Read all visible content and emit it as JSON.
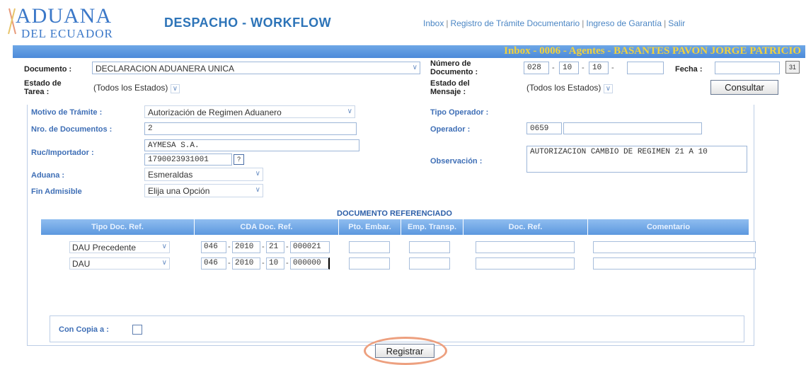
{
  "logo": {
    "main": "ADUANA",
    "sub": "DEL ECUADOR"
  },
  "app_title": "DESPACHO - WORKFLOW",
  "nav": [
    "Inbox",
    "Registro de Trámite Documentario",
    "Ingreso de Garantía",
    "Salir"
  ],
  "banner": "Inbox - 0006 - Agentes - BASANTES PAVON JORGE PATRICIO",
  "filters": {
    "documento_label": "Documento :",
    "documento_value": "DECLARACION ADUANERA UNICA",
    "numero_label_1": "Número de",
    "numero_label_2": "Documento :",
    "numero_parts": [
      "028",
      "10",
      "10",
      ""
    ],
    "fecha_label": "Fecha :",
    "fecha_value": "",
    "estado_tarea_label_1": "Estado de",
    "estado_tarea_label_2": "Tarea :",
    "estado_tarea_value": "(Todos los Estados)",
    "estado_mensaje_label_1": "Estado del",
    "estado_mensaje_label_2": "Mensaje :",
    "estado_mensaje_value": "(Todos los Estados)",
    "consultar": "Consultar"
  },
  "form": {
    "motivo_label": "Motivo de Trámite :",
    "motivo_value": "Autorización de Regimen Aduanero",
    "nro_docs_label": "Nro. de Documentos :",
    "nro_docs_value": "2",
    "ruc_label": "Ruc/Importador :",
    "ruc_name": "AYMESA S.A.",
    "ruc_number": "1790023931001",
    "ruc_help": "?",
    "aduana_label": "Aduana :",
    "aduana_value": "Esmeraldas",
    "fin_label": "Fin Admisible",
    "fin_value": "Elija una Opción",
    "tipo_operador_label": "Tipo Operador :",
    "operador_label": "Operador :",
    "operador_code": "0659",
    "observacion_label": "Observación :",
    "observacion_value": "AUTORIZACION CAMBIO DE REGIMEN 21 A 10"
  },
  "doc_ref": {
    "title": "DOCUMENTO REFERENCIADO",
    "columns": [
      "Tipo Doc. Ref.",
      "CDA Doc. Ref.",
      "Pto. Embar.",
      "Emp. Transp.",
      "Doc. Ref.",
      "Comentario"
    ],
    "rows": [
      {
        "tipo": "DAU Precedente",
        "cda": [
          "046",
          "2010",
          "21",
          "000021"
        ]
      },
      {
        "tipo": "DAU",
        "cda": [
          "046",
          "2010",
          "10",
          "000000"
        ]
      }
    ]
  },
  "con_copia_label": "Con Copia a :",
  "registrar": "Registrar",
  "colors": {
    "banner": "#4c8ad9",
    "banner_text": "#f4d23a",
    "label_blue": "#3f6fb6",
    "accent": "#2d74b8"
  }
}
